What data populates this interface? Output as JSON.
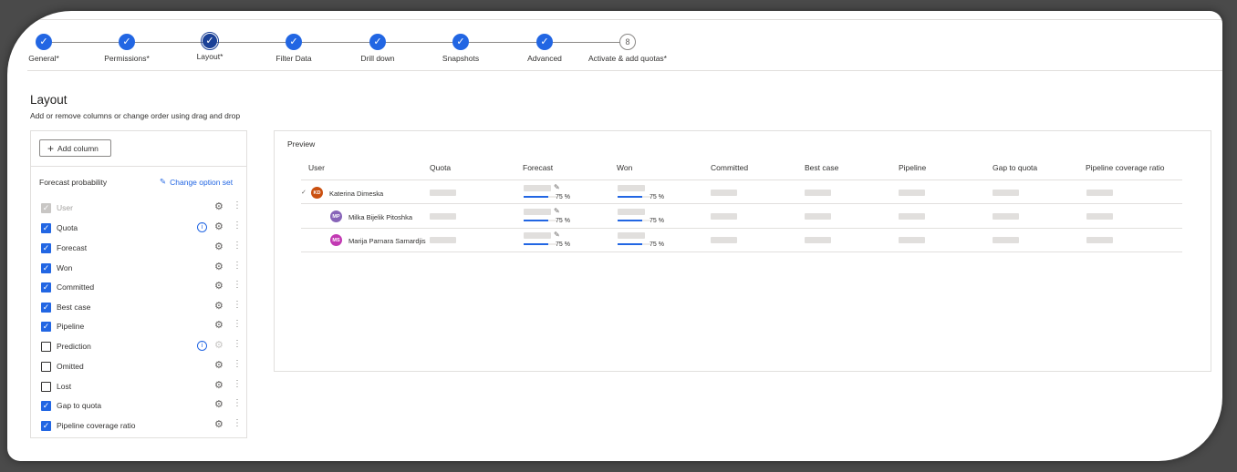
{
  "steps": [
    {
      "label": "General*",
      "status": "done"
    },
    {
      "label": "Permissions*",
      "status": "done"
    },
    {
      "label": "Layout*",
      "status": "active"
    },
    {
      "label": "Filter Data",
      "status": "done"
    },
    {
      "label": "Drill down",
      "status": "done"
    },
    {
      "label": "Snapshots",
      "status": "done"
    },
    {
      "label": "Advanced",
      "status": "done"
    },
    {
      "label": "Activate & add quotas*",
      "status": "pending",
      "number": "8"
    }
  ],
  "page": {
    "title": "Layout",
    "subtitle": "Add or remove columns or change order using drag and drop"
  },
  "left_panel": {
    "add_column_label": "Add column",
    "section_label": "Forecast probability",
    "change_option_set_label": "Change option set",
    "options": [
      {
        "label": "User",
        "checked": true,
        "disabled": true,
        "info": false
      },
      {
        "label": "Quota",
        "checked": true,
        "disabled": false,
        "info": true
      },
      {
        "label": "Forecast",
        "checked": true,
        "disabled": false,
        "info": false
      },
      {
        "label": "Won",
        "checked": true,
        "disabled": false,
        "info": false
      },
      {
        "label": "Committed",
        "checked": true,
        "disabled": false,
        "info": false
      },
      {
        "label": "Best case",
        "checked": true,
        "disabled": false,
        "info": false
      },
      {
        "label": "Pipeline",
        "checked": true,
        "disabled": false,
        "info": false
      },
      {
        "label": "Prediction",
        "checked": false,
        "disabled": false,
        "info": true
      },
      {
        "label": "Omitted",
        "checked": false,
        "disabled": false,
        "info": false
      },
      {
        "label": "Lost",
        "checked": false,
        "disabled": false,
        "info": false
      },
      {
        "label": "Gap to quota",
        "checked": true,
        "disabled": false,
        "info": false
      },
      {
        "label": "Pipeline coverage ratio",
        "checked": true,
        "disabled": false,
        "info": false
      }
    ]
  },
  "preview": {
    "title": "Preview",
    "columns": [
      "User",
      "Quota",
      "Forecast",
      "Won",
      "Committed",
      "Best case",
      "Pipeline",
      "Gap to quota",
      "Pipeline coverage ratio"
    ],
    "rows": [
      {
        "initials": "KD",
        "name": "Katerina Dimeska",
        "avatar_color": "#ca5010",
        "forecast_pct": "75 %",
        "won_pct": "75 %",
        "progress": 0.75
      },
      {
        "initials": "MP",
        "name": "Milka Bijelik Pitoshka",
        "avatar_color": "#8764b8",
        "forecast_pct": "75 %",
        "won_pct": "75 %",
        "progress": 0.75
      },
      {
        "initials": "MS",
        "name": "Marija Parnara Samardjis",
        "avatar_color": "#c239b3",
        "forecast_pct": "75 %",
        "won_pct": "75 %",
        "progress": 0.75
      }
    ]
  },
  "colors": {
    "accent": "#2266e3",
    "active_step": "#1b4197"
  }
}
